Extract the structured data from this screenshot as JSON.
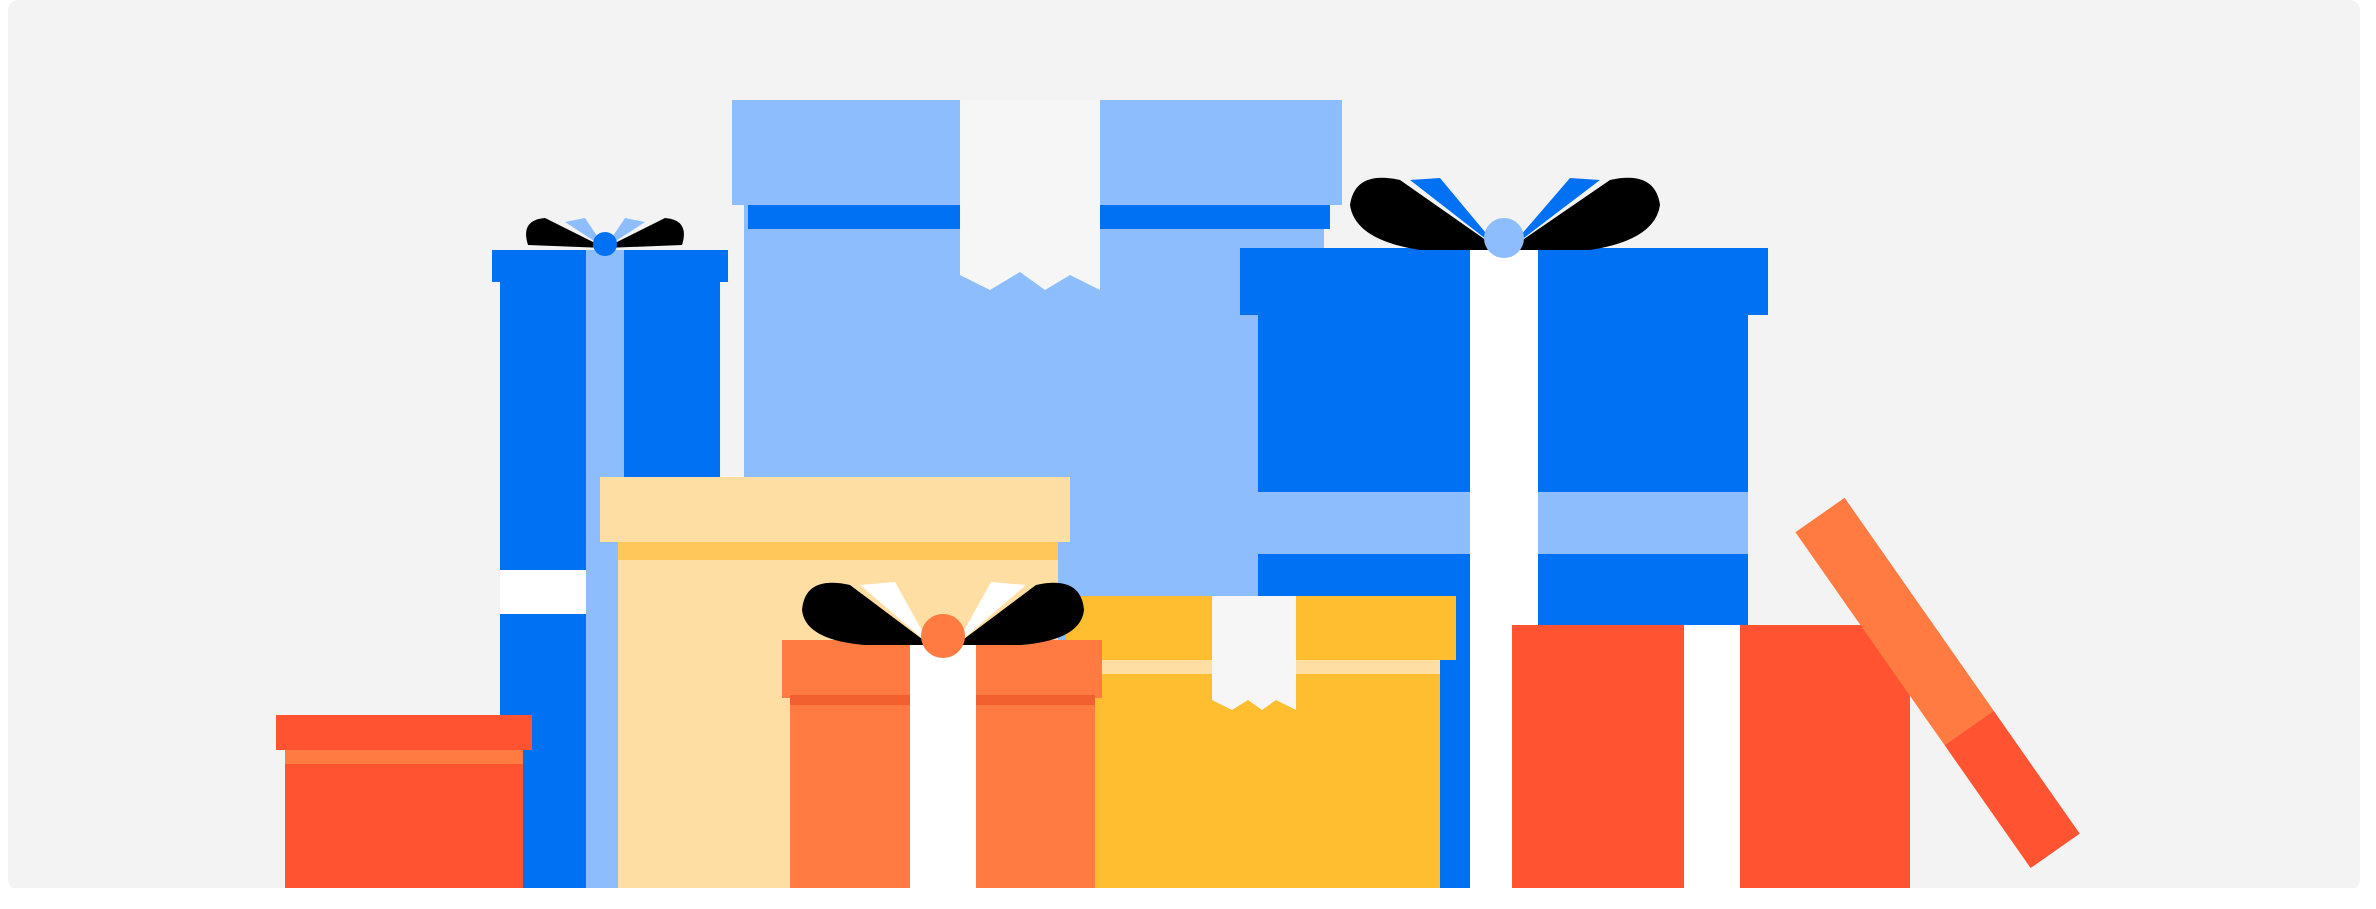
{
  "illustration": {
    "subject": "gift-boxes",
    "colors": {
      "background": "#f3f3f3",
      "blue_dark": "#0071f2",
      "blue_light": "#8dbdfc",
      "peach": "#ffdea3",
      "peach_band": "#ffc65a",
      "orange": "#ff7b41",
      "orange_dark": "#f2602f",
      "yellow": "#ffbd2f",
      "red": "#ff5331",
      "white": "#ffffff",
      "black": "#000000"
    }
  }
}
